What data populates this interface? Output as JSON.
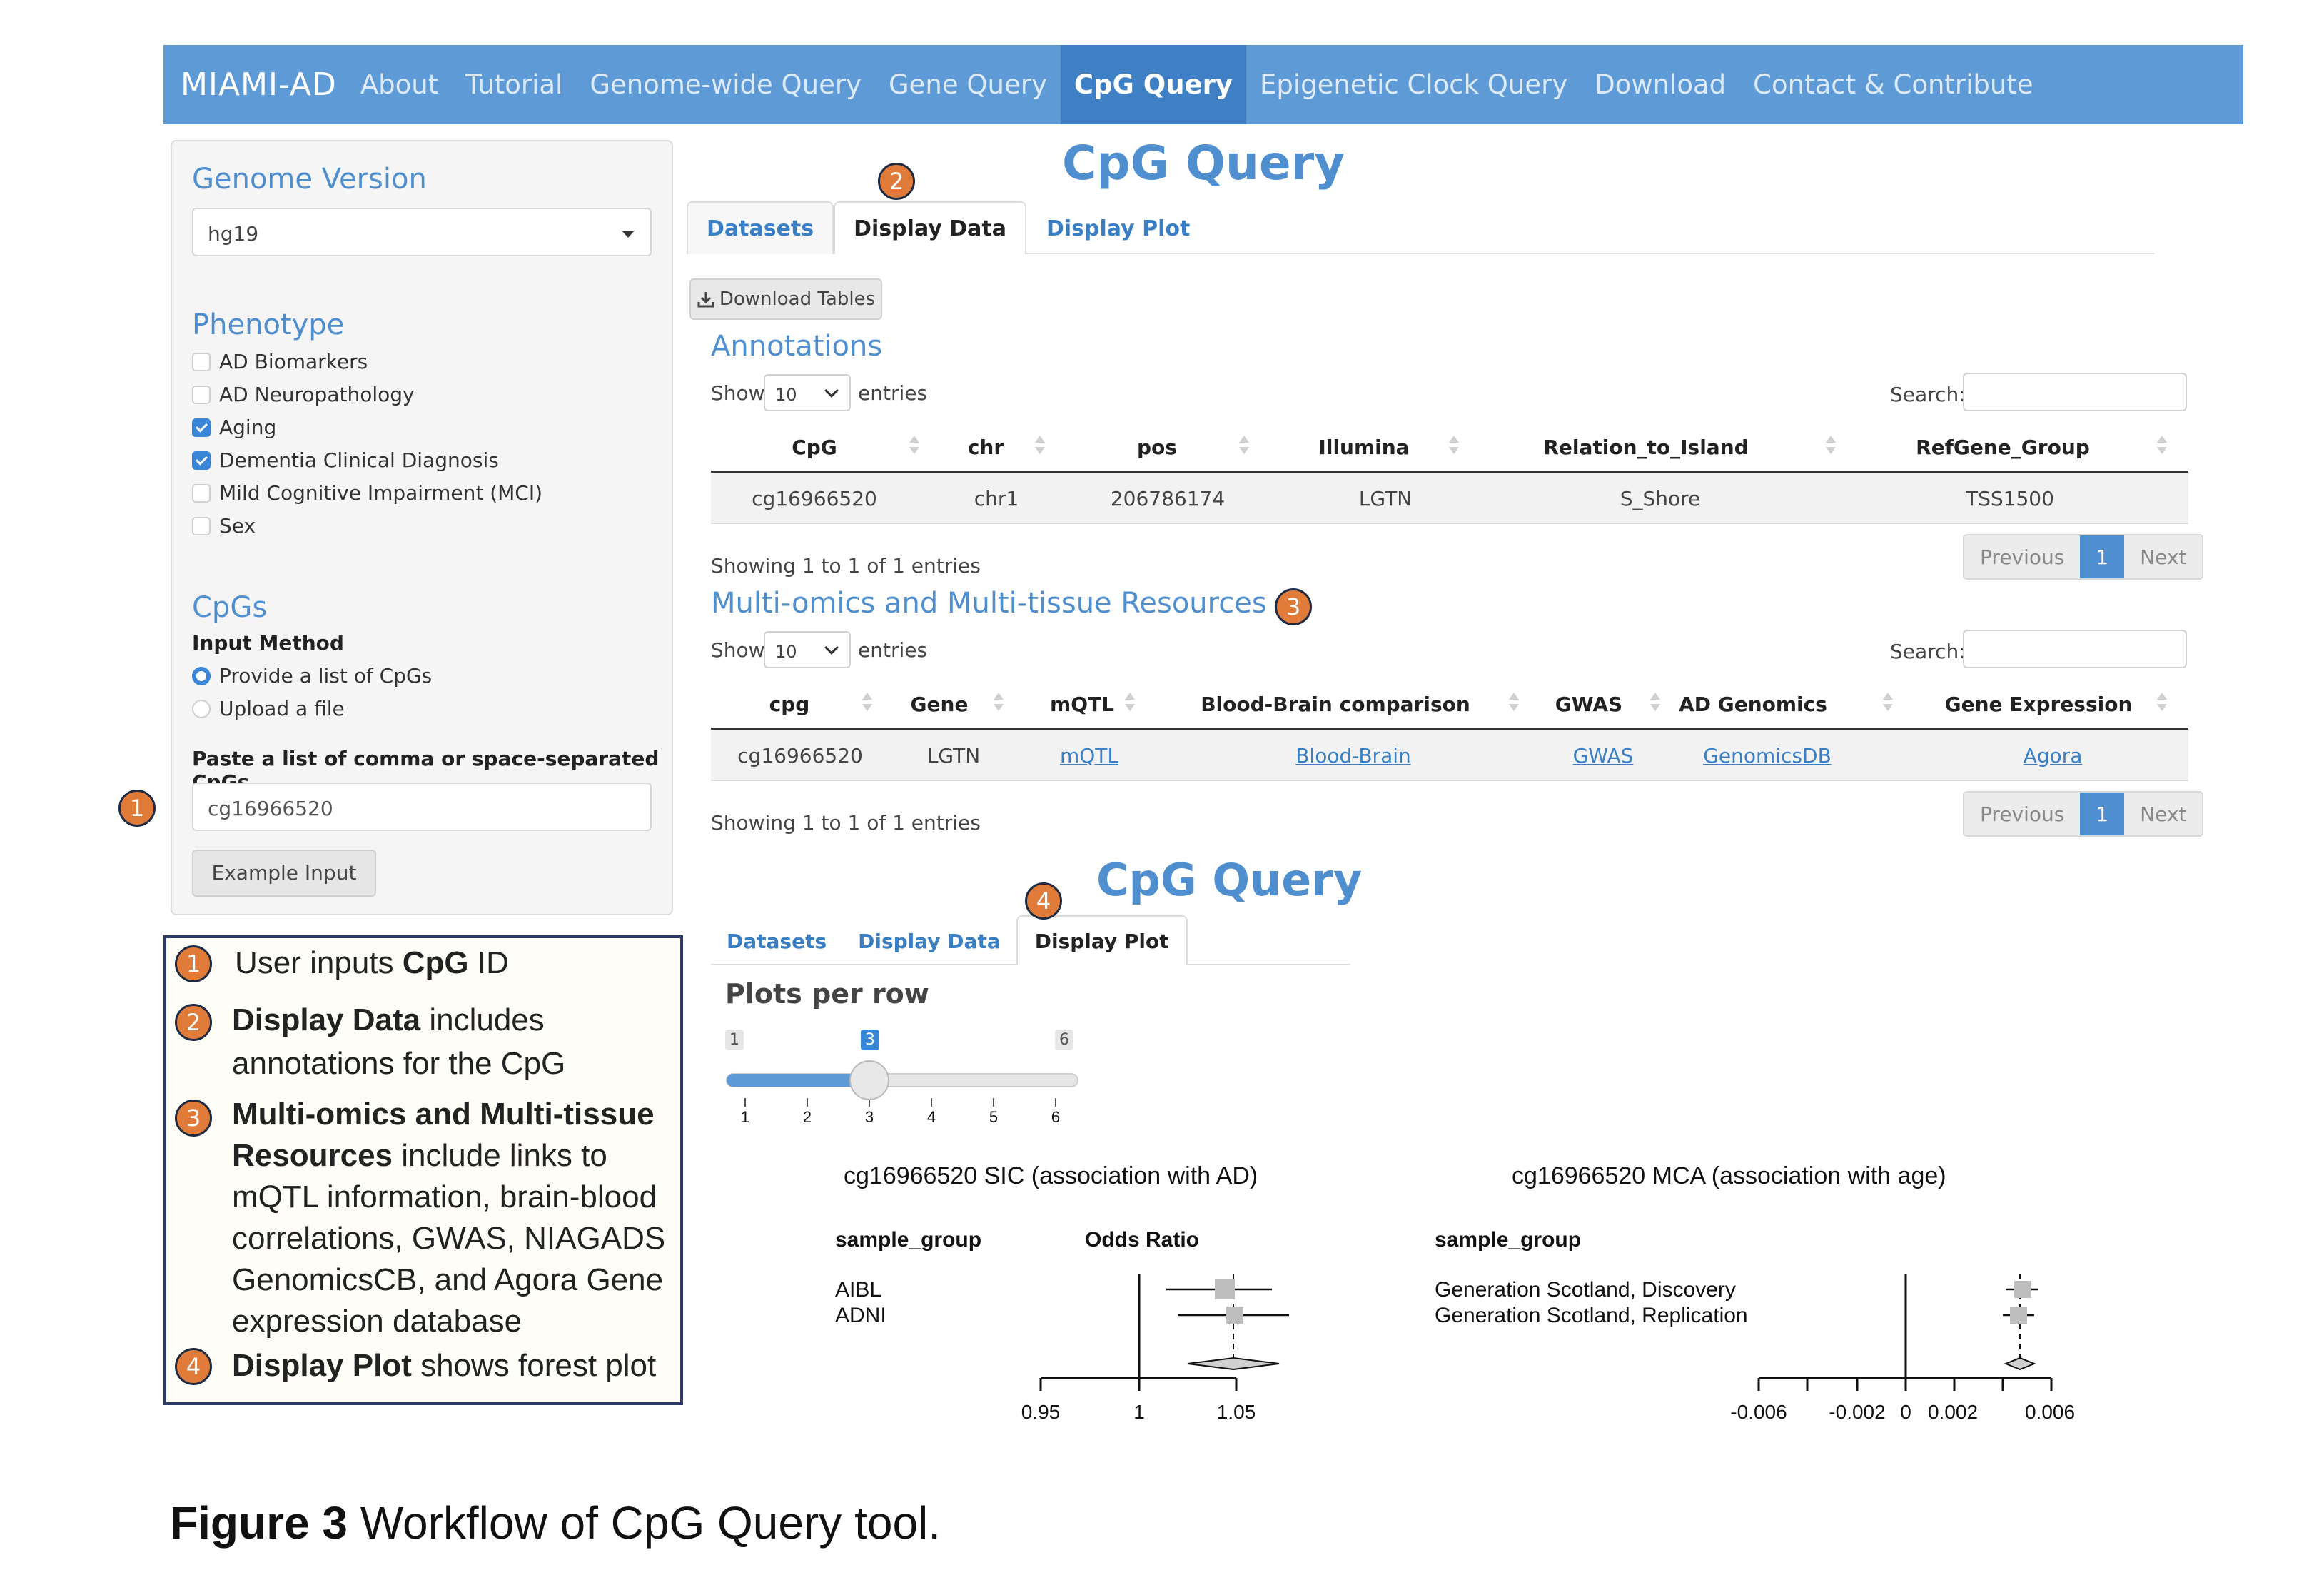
{
  "navbar": {
    "brand": "MIAMI-AD",
    "items": [
      "About",
      "Tutorial",
      "Genome-wide Query",
      "Gene Query",
      "CpG Query",
      "Epigenetic Clock Query",
      "Download",
      "Contact & Contribute"
    ],
    "active": "CpG Query"
  },
  "sidebar": {
    "genome_version_title": "Genome Version",
    "genome_version_value": "hg19",
    "phenotype_title": "Phenotype",
    "phenotypes": [
      {
        "label": "AD Biomarkers",
        "checked": false
      },
      {
        "label": "AD Neuropathology",
        "checked": false
      },
      {
        "label": "Aging",
        "checked": true
      },
      {
        "label": "Dementia Clinical Diagnosis",
        "checked": true
      },
      {
        "label": "Mild Cognitive Impairment (MCI)",
        "checked": false
      },
      {
        "label": "Sex",
        "checked": false
      }
    ],
    "cpgs_title": "CpGs",
    "input_method_label": "Input Method",
    "input_methods": [
      {
        "label": "Provide a list of CpGs",
        "selected": true
      },
      {
        "label": "Upload a file",
        "selected": false
      }
    ],
    "paste_label": "Paste a list of comma or space-separated CpGs",
    "cpg_input_value": "cg16966520",
    "example_button": "Example Input"
  },
  "main": {
    "title": "CpG Query",
    "tabs": [
      "Datasets",
      "Display Data",
      "Display Plot"
    ],
    "download_button": "Download Tables",
    "show_label": "Show",
    "entries_label": "entries",
    "search_label": "Search:",
    "page_length": "10",
    "annotations": {
      "title": "Annotations",
      "columns": [
        "CpG",
        "chr",
        "pos",
        "Illumina",
        "Relation_to_Island",
        "RefGene_Group"
      ],
      "rows": [
        [
          "cg16966520",
          "chr1",
          "206786174",
          "LGTN",
          "S_Shore",
          "TSS1500"
        ]
      ],
      "info": "Showing 1 to 1 of 1 entries"
    },
    "multiomics": {
      "title": "Multi-omics and Multi-tissue Resources",
      "columns": [
        "cpg",
        "Gene",
        "mQTL",
        "Blood-Brain comparison",
        "GWAS",
        "AD Genomics",
        "Gene Expression"
      ],
      "rows": [
        [
          "cg16966520",
          "LGTN",
          "mQTL",
          "Blood-Brain",
          "GWAS",
          "GenomicsDB",
          "Agora"
        ]
      ],
      "info": "Showing 1 to 1 of 1 entries"
    },
    "pager": {
      "previous": "Previous",
      "page": "1",
      "next": "Next"
    }
  },
  "plot_panel": {
    "title": "CpG Query",
    "tabs": [
      "Datasets",
      "Display Data",
      "Display Plot"
    ],
    "plots_per_row_label": "Plots per row",
    "slider": {
      "min": "1",
      "max": "6",
      "value": "3",
      "ticks": [
        "1",
        "2",
        "3",
        "4",
        "5",
        "6"
      ]
    }
  },
  "plots": [
    {
      "title": "cg16966520 SIC (association with AD)",
      "group_header": "sample_group",
      "measure_header": "Odds Ratio",
      "groups": [
        "AIBL",
        "ADNI"
      ],
      "ticks": [
        "0.95",
        "1",
        "1.05"
      ]
    },
    {
      "title": "cg16966520 MCA (association with age)",
      "group_header": "sample_group",
      "groups": [
        "Generation Scotland, Discovery",
        "Generation Scotland, Replication"
      ],
      "ticks": [
        "-0.006",
        "-0.002",
        "0",
        "0.002",
        "0.006"
      ]
    }
  ],
  "badges": [
    "1",
    "2",
    "3",
    "4"
  ],
  "legend": {
    "item1": {
      "pre": "User inputs ",
      "bold": "CpG",
      "post": " ID"
    },
    "item2": {
      "bold": "Display Data",
      "post": " includes annotations for the CpG"
    },
    "item3": {
      "bold": "Multi-omics and Multi-tissue Resources",
      "post": " include links to mQTL information, brain-blood correlations, GWAS, NIAGADS GenomicsCB, and Agora Gene expression database"
    },
    "item4": {
      "bold": "Display Plot",
      "post": " shows forest plot"
    }
  },
  "caption": {
    "bold": "Figure 3",
    "text": " Workflow of CpG Query tool."
  },
  "colors": {
    "nav": "#5d9ad6",
    "accent": "#4f8fd0",
    "badge": "#e07b39",
    "legend_border": "#2b3a67"
  }
}
